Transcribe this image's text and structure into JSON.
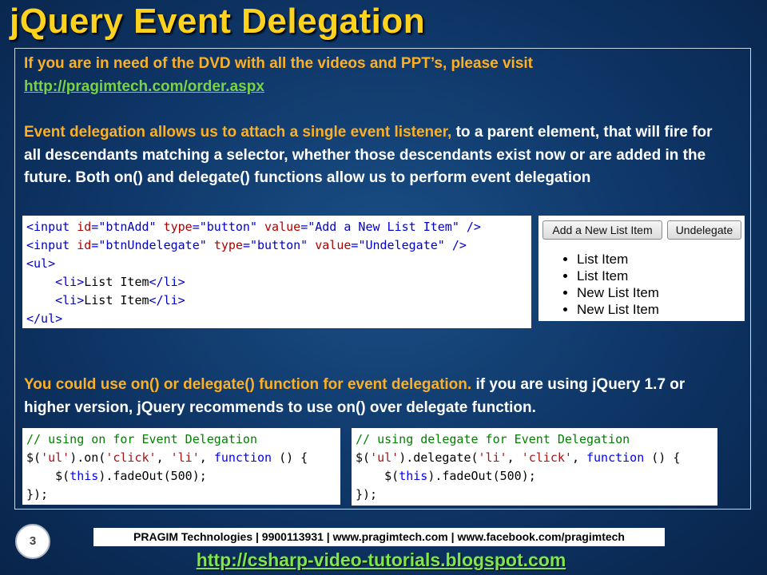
{
  "slide": {
    "title": "jQuery Event Delegation",
    "dvd_line": "If you are in need of the DVD with all the videos and PPT’s, please visit",
    "dvd_url": "http://pragimtech.com/order.aspx",
    "para1_highlight": "Event delegation allows us to attach a single event listener,",
    "para1_rest": " to a parent element, that will fire for all descendants matching a selector, whether those descendants exist now or are added in the future. Both on() and delegate() functions allow us to perform event delegation",
    "para2_highlight": "You could use on() or delegate() function for event delegation.",
    "para2_rest": " if you are using jQuery 1.7 or higher version, jQuery recommends to use on() over delegate function.",
    "page_number": "3"
  },
  "html_code": {
    "line1": {
      "open": "<input ",
      "a1": "id",
      "v1": "\"btnAdd\"",
      "a2": "type",
      "v2": "\"button\"",
      "a3": "value",
      "v3": "\"Add a New List Item\"",
      "close": " />"
    },
    "line2": {
      "open": "<input ",
      "a1": "id",
      "v1": "\"btnUndelegate\"",
      "a2": "type",
      "v2": "\"button\"",
      "a3": "value",
      "v3": "\"Undelegate\"",
      "close": " />"
    },
    "line3": "<ul>",
    "li_open": "<li>",
    "li_text": "List Item",
    "li_close": "</li>",
    "line6": "</ul>"
  },
  "preview": {
    "btn_add": "Add a New List Item",
    "btn_undelegate": "Undelegate",
    "items": [
      "List Item",
      "List Item",
      "New List Item",
      "New List Item"
    ]
  },
  "code_on": {
    "comment": "// using on for Event Delegation",
    "l2_a": "$(",
    "l2_s1": "'ul'",
    "l2_b": ").on(",
    "l2_s2": "'click'",
    "l2_c": ", ",
    "l2_s3": "'li'",
    "l2_d": ", ",
    "l2_kw": "function",
    "l2_e": " () {",
    "l3_a": "    $(",
    "l3_kw": "this",
    "l3_b": ").fadeOut(500);",
    "l4": "});"
  },
  "code_delegate": {
    "comment": "// using delegate for Event Delegation",
    "l2_a": "$(",
    "l2_s1": "'ul'",
    "l2_b": ").delegate(",
    "l2_s2": "'li'",
    "l2_c": ", ",
    "l2_s3": "'click'",
    "l2_d": ", ",
    "l2_kw": "function",
    "l2_e": " () {",
    "l3_a": "    $(",
    "l3_kw": "this",
    "l3_b": ").fadeOut(500);",
    "l4": "});"
  },
  "footer": {
    "bar": "PRAGIM Technologies | 9900113931 | www.pragimtech.com | www.facebook.com/pragimtech",
    "url": "http://csharp-video-tutorials.blogspot.com"
  },
  "colors": {
    "title": "#ffd21e",
    "highlight": "#ffb020",
    "link": "#78d24a",
    "background": "#0e3566"
  }
}
